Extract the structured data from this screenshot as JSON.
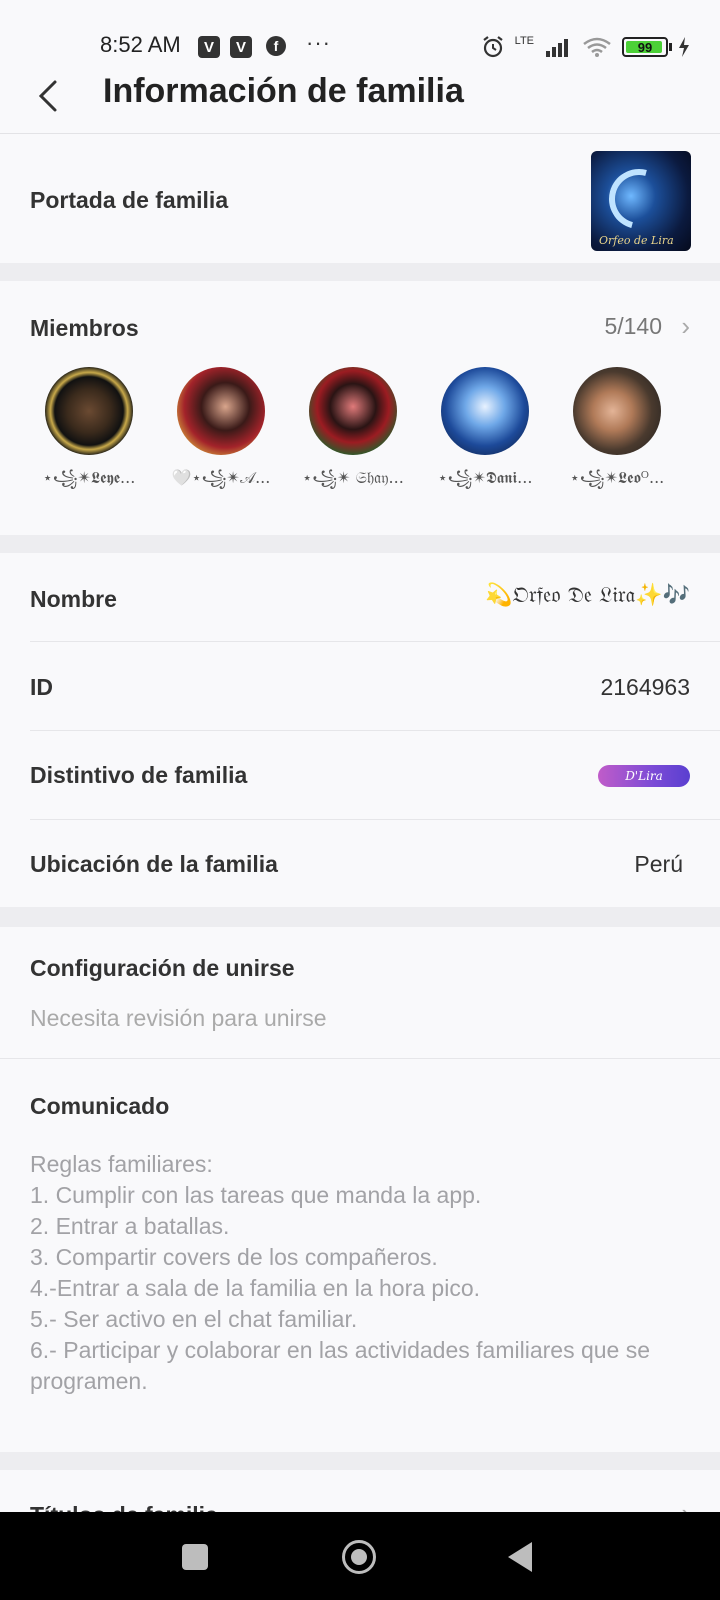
{
  "status_bar": {
    "time": "8:52 AM",
    "app_icon_1": "V",
    "app_icon_2": "V",
    "facebook": "f",
    "more": "···",
    "network": "LTE",
    "battery": "99"
  },
  "header": {
    "title": "Información de familia"
  },
  "cover": {
    "label": "Portada de familia",
    "image_text": "Orfeo de Lira"
  },
  "members": {
    "label": "Miembros",
    "count": "5/140",
    "list": [
      {
        "name": "⋆꧁✴𝕷𝖊𝖞𝖊..."
      },
      {
        "name": "🤍⋆꧁✴𝒜..."
      },
      {
        "name": "⋆꧁✴ 𝔖𝔥𝔞𝔶..."
      },
      {
        "name": "⋆꧁✴𝕯𝖆𝖓𝖎..."
      },
      {
        "name": "⋆꧁✴𝕷𝖊𝖔ᴼ..."
      }
    ]
  },
  "info": {
    "name_label": "Nombre",
    "name_value": "💫𝔒𝔯𝔣𝔢𝔬 𝔇𝔢 𝔏𝔦𝔯𝔞✨🎶",
    "id_label": "ID",
    "id_value": "2164963",
    "badge_label": "Distintivo de familia",
    "badge_value": "D'Lira",
    "location_label": "Ubicación de la familia",
    "location_value": "Perú"
  },
  "join": {
    "label": "Configuración de unirse",
    "value": "Necesita revisión para unirse"
  },
  "announcement": {
    "label": "Comunicado",
    "text": "Reglas familiares:\n1. Cumplir con las tareas que manda la app.\n2. Entrar a batallas.\n3. Compartir covers de los compañeros.\n4.-Entrar a sala de la familia en la hora pico.\n5.- Ser activo en el chat familiar.\n6.- Participar y colaborar en las actividades familiares que se programen."
  },
  "titles": {
    "label": "Títulos de familia"
  },
  "colors": {
    "accent": "#7b4bd6",
    "battery": "#4cd137",
    "background": "#f9f9fb"
  }
}
